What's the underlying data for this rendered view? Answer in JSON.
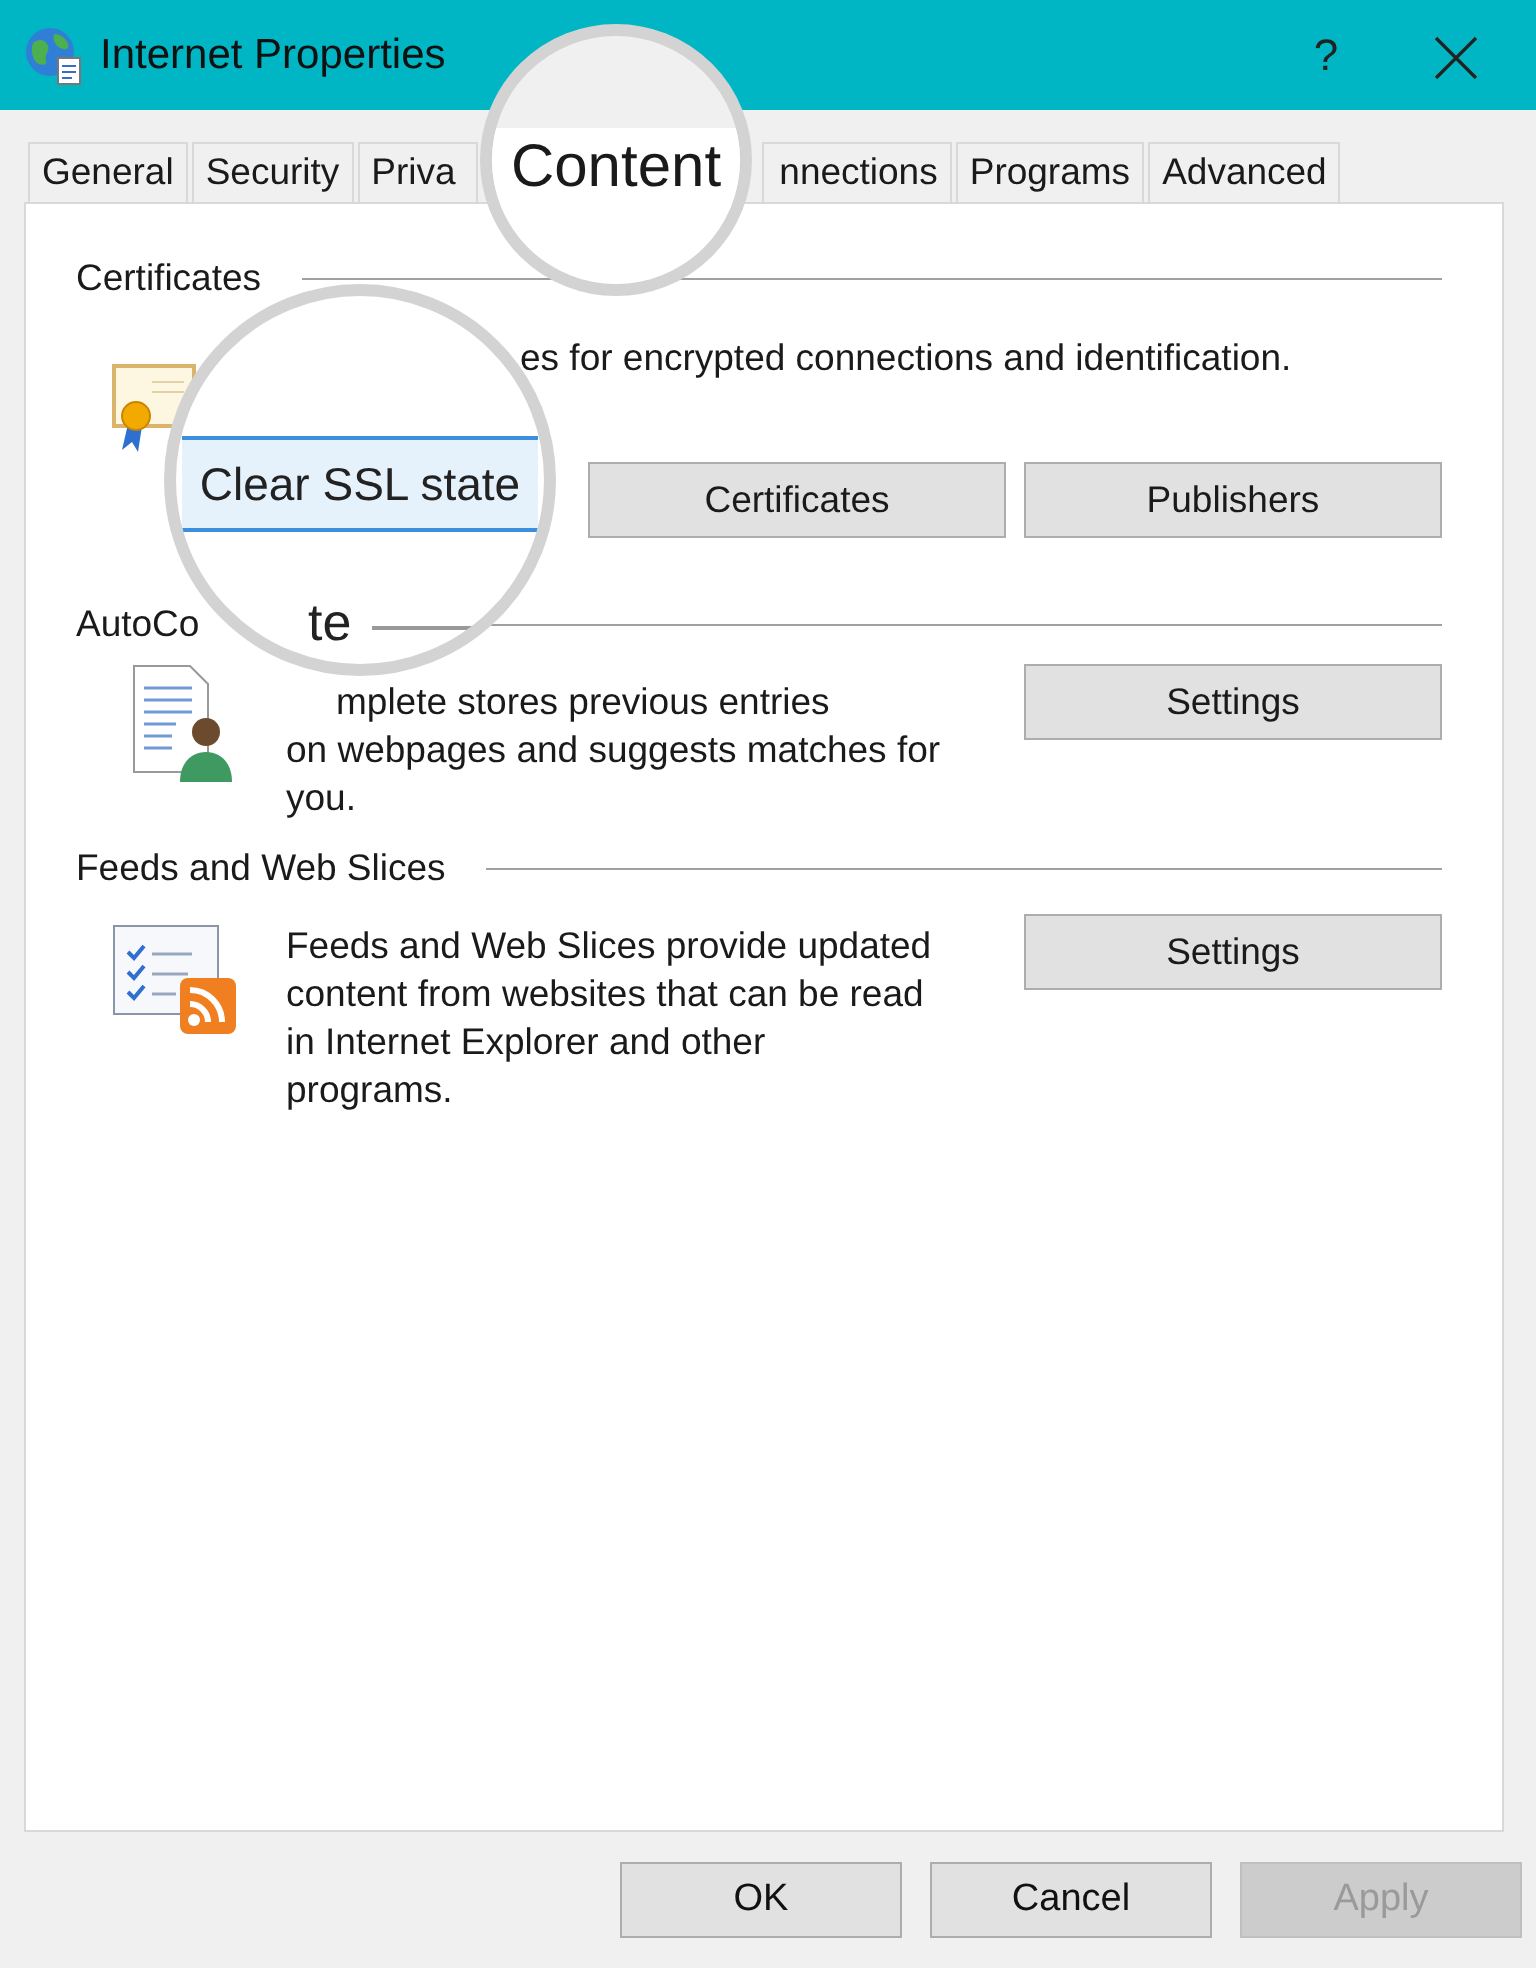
{
  "window": {
    "title": "Internet Properties",
    "help": "?"
  },
  "tabs": [
    {
      "label": "General",
      "selected": false,
      "kind": "plain"
    },
    {
      "label": "Security",
      "selected": false,
      "kind": "plain"
    },
    {
      "label": "Priva",
      "selected": false,
      "kind": "cut"
    },
    {
      "label": "Content",
      "selected": true,
      "kind": "magnified"
    },
    {
      "label": "nnections",
      "selected": false,
      "kind": "plain"
    },
    {
      "label": "Programs",
      "selected": false,
      "kind": "plain"
    },
    {
      "label": "Advanced",
      "selected": false,
      "kind": "plain"
    }
  ],
  "certificates": {
    "heading": "Certificates",
    "description": "es for encrypted connections and identification.",
    "buttons": [
      {
        "label": "Clear SSL state",
        "kind": "magnified"
      },
      {
        "label": "Certificates",
        "kind": "plain"
      },
      {
        "label": "Publishers",
        "kind": "plain"
      }
    ]
  },
  "autocomplete": {
    "heading": "AutoCo",
    "magnified_fragment": "te",
    "lines": [
      "mplete stores previous entries",
      "on webpages and suggests matches for",
      "you."
    ],
    "button": "Settings"
  },
  "feeds": {
    "heading": "Feeds and Web Slices",
    "lines": [
      "Feeds and Web Slices provide updated",
      "content from websites that can be read",
      "in Internet Explorer and other",
      "programs."
    ],
    "button": "Settings"
  },
  "footer": [
    {
      "label": "OK",
      "disabled": false
    },
    {
      "label": "Cancel",
      "disabled": false
    },
    {
      "label": "Apply",
      "disabled": true
    }
  ]
}
